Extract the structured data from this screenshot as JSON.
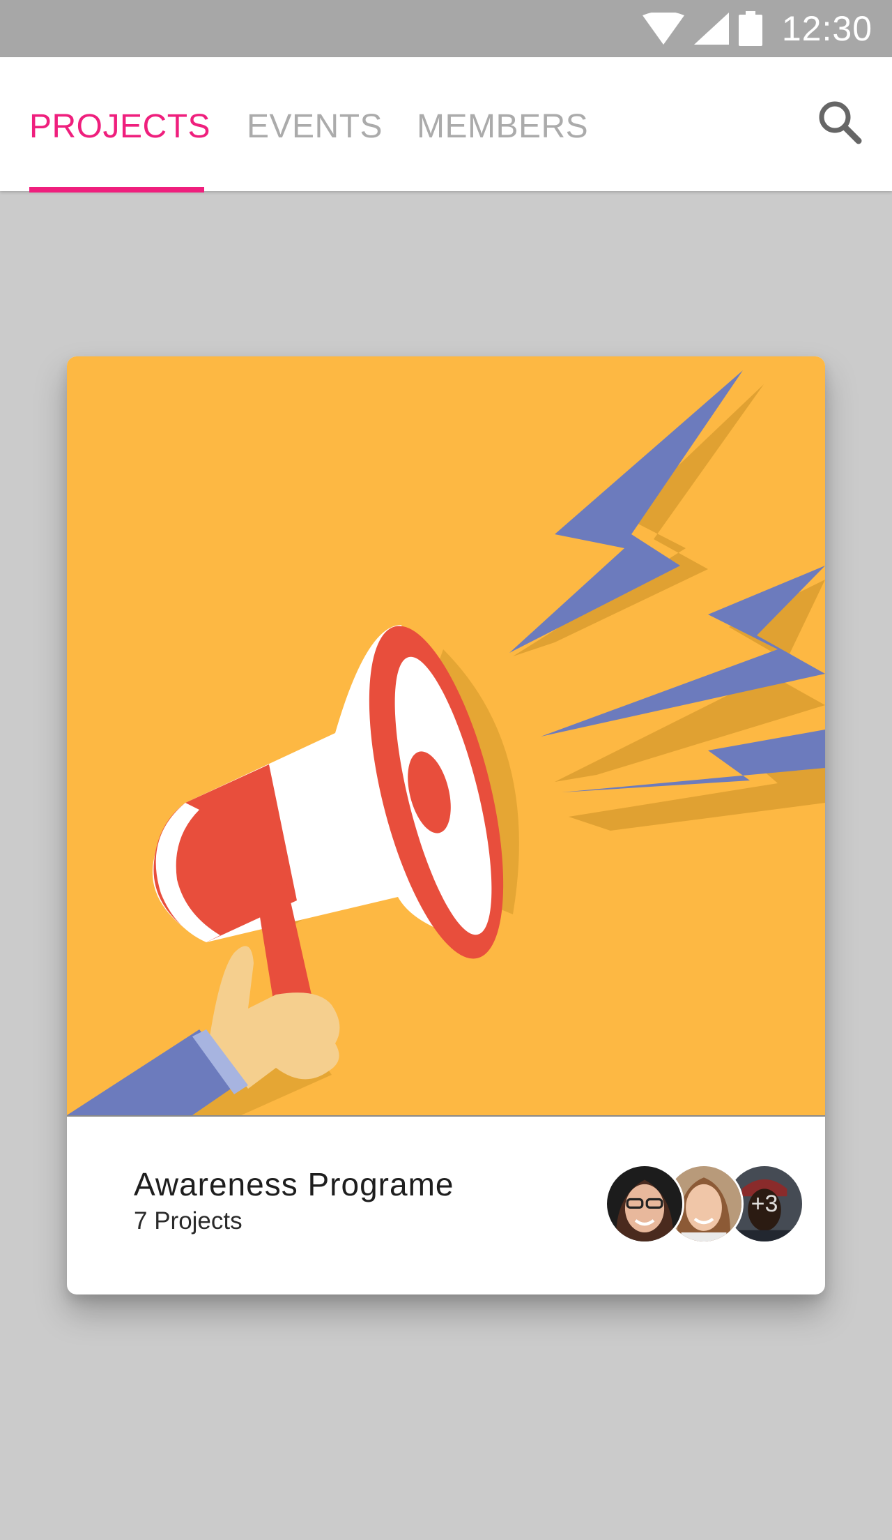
{
  "status_bar": {
    "time": "12:30",
    "icons": [
      "wifi-icon",
      "signal-icon",
      "battery-icon"
    ],
    "color": "#a7a7a7"
  },
  "tabs": [
    {
      "label": "PROJECTS",
      "active": true
    },
    {
      "label": "EVENTS",
      "active": false
    },
    {
      "label": "MEMBERS",
      "active": false
    }
  ],
  "toolbar": {
    "search_icon": "search-icon"
  },
  "card": {
    "title": "Awareness Programe",
    "subtitle": "7 Projects",
    "image": "megaphone-illustration",
    "members": {
      "avatars": [
        "member-avatar",
        "member-avatar",
        "member-avatar"
      ],
      "more_label": "+3"
    }
  },
  "colors": {
    "accent": "#ef1f7d",
    "inactive_tab": "#ababab",
    "background": "#cbcbcb",
    "image_background": "#fdb843",
    "megaphone_red": "#e84e3c",
    "bolt_blue": "#6c7bbd"
  }
}
